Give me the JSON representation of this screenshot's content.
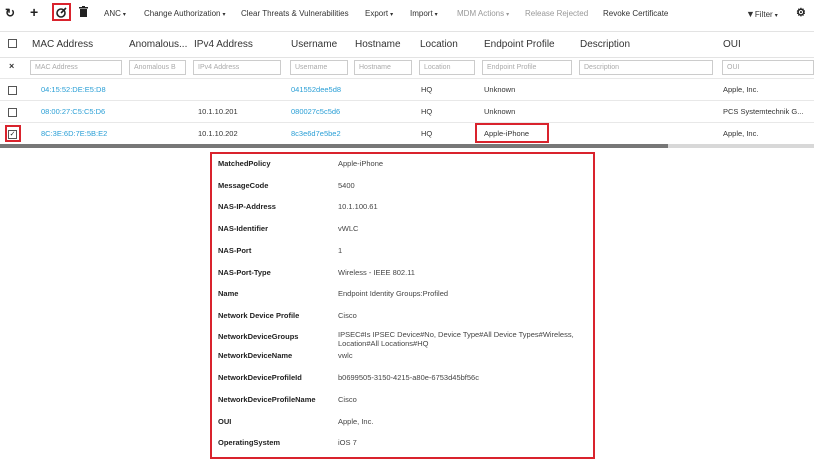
{
  "toolbar": {
    "refresh_icon": "refresh-icon",
    "add_icon": "plus-icon",
    "edit_icon": "edit-icon",
    "delete_icon": "trash-icon",
    "anc": "ANC",
    "change_authorization": "Change Authorization",
    "clear_threats": "Clear Threats & Vulnerabilities",
    "export": "Export",
    "import": "Import",
    "mdm_actions": "MDM Actions",
    "release_rejected": "Release Rejected",
    "revoke_certificate": "Revoke Certificate",
    "filter": "Filter",
    "settings_icon": "gear-icon",
    "accent_red": "#d9232d"
  },
  "columns": [
    "MAC Address",
    "Anomalous...",
    "IPv4 Address",
    "Username",
    "Hostname",
    "Location",
    "Endpoint Profile",
    "Description",
    "OUI"
  ],
  "filters": [
    "MAC Address",
    "Anomalous B",
    "IPv4 Address",
    "Username",
    "Hostname",
    "Location",
    "Endpoint Profile",
    "Description",
    "OUI"
  ],
  "rows": [
    {
      "mac": "04:15:52:DE:E5:D8",
      "ipv4": "",
      "username": "041552dee5d8",
      "location": "HQ",
      "profile": "Unknown",
      "oui": "Apple, Inc.",
      "checked": false
    },
    {
      "mac": "08:00:27:C5:C5:D6",
      "ipv4": "10.1.10.201",
      "username": "080027c5c5d6",
      "location": "HQ",
      "profile": "Unknown",
      "oui": "PCS Systemtechnik G...",
      "checked": false
    },
    {
      "mac": "8C:3E:6D:7E:5B:E2",
      "ipv4": "10.1.10.202",
      "username": "8c3e6d7e5be2",
      "location": "HQ",
      "profile": "Apple-iPhone",
      "oui": "Apple, Inc.",
      "checked": true
    }
  ],
  "details": [
    {
      "key": "MatchedPolicy",
      "value": "Apple-iPhone"
    },
    {
      "key": "MessageCode",
      "value": "5400"
    },
    {
      "key": "NAS-IP-Address",
      "value": "10.1.100.61"
    },
    {
      "key": "NAS-Identifier",
      "value": "vWLC"
    },
    {
      "key": "NAS-Port",
      "value": "1"
    },
    {
      "key": "NAS-Port-Type",
      "value": "Wireless - IEEE 802.11"
    },
    {
      "key": "Name",
      "value": "Endpoint Identity Groups:Profiled"
    },
    {
      "key": "Network Device Profile",
      "value": "Cisco"
    },
    {
      "key": "NetworkDeviceGroups",
      "value": "IPSEC#Is IPSEC Device#No, Device Type#All Device Types#Wireless, Location#All Locations#HQ"
    },
    {
      "key": "NetworkDeviceName",
      "value": "vwlc"
    },
    {
      "key": "NetworkDeviceProfileId",
      "value": "b0699505-3150-4215-a80e-6753d45bf56c"
    },
    {
      "key": "NetworkDeviceProfileName",
      "value": "Cisco"
    },
    {
      "key": "OUI",
      "value": "Apple, Inc."
    },
    {
      "key": "OperatingSystem",
      "value": "iOS 7"
    }
  ]
}
